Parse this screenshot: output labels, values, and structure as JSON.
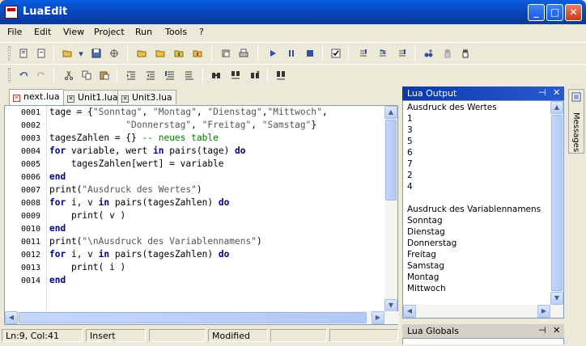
{
  "window": {
    "title": "LuaEdit",
    "minimize": "_",
    "maximize": "□",
    "close": "✕"
  },
  "menu": [
    {
      "label": "File"
    },
    {
      "label": "Edit"
    },
    {
      "label": "View"
    },
    {
      "label": "Project"
    },
    {
      "label": "Run"
    },
    {
      "label": "Tools"
    },
    {
      "label": "?"
    }
  ],
  "tabs": [
    {
      "label": "next.lua",
      "active": true
    },
    {
      "label": "Unit1.lua",
      "active": false
    },
    {
      "label": "Unit3.lua",
      "active": false
    }
  ],
  "editor": {
    "line_numbers": [
      "0001",
      "0002",
      "0003",
      "0004",
      "0005",
      "0006",
      "0007",
      "0008",
      "0009",
      "0010",
      "0011",
      "0012",
      "0013",
      "0014"
    ],
    "lines": [
      "tage = {\"Sonntag\", \"Montag\", \"Dienstag\",\"Mittwoch\",",
      "              \"Donnerstag\", \"Freitag\", \"Samstag\"}",
      "tagesZahlen = {} -- neues table",
      "for variable, wert in pairs(tage) do",
      "    tagesZahlen[wert] = variable",
      "end",
      "print(\"Ausdruck des Wertes\")",
      "for i, v in pairs(tagesZahlen) do",
      "    print( v )",
      "end",
      "print(\"\\nAusdruck des Variablennamens\")",
      "for i, v in pairs(tagesZahlen) do",
      "    print( i )",
      "end"
    ]
  },
  "lua_output": {
    "title": "Lua Output",
    "pin": "⊣",
    "close": "✕",
    "lines": [
      "Ausdruck des Wertes",
      "1",
      "3",
      "5",
      "6",
      "7",
      "2",
      "4",
      "",
      "Ausdruck des Variablennamens",
      "Sonntag",
      "Dienstag",
      "Donnerstag",
      "Freitag",
      "Samstag",
      "Montag",
      "Mittwoch"
    ]
  },
  "lua_globals": {
    "title": "Lua Globals",
    "pin": "⊣",
    "close": "✕"
  },
  "side_tab": {
    "label": "Messages"
  },
  "status": {
    "position": "Ln:9, Col:41",
    "mode": "Insert",
    "state": "Modified"
  },
  "colors": {
    "title_bar": "#0842b5",
    "keyword": "#00008b",
    "comment": "#008000",
    "string": "#555555"
  }
}
